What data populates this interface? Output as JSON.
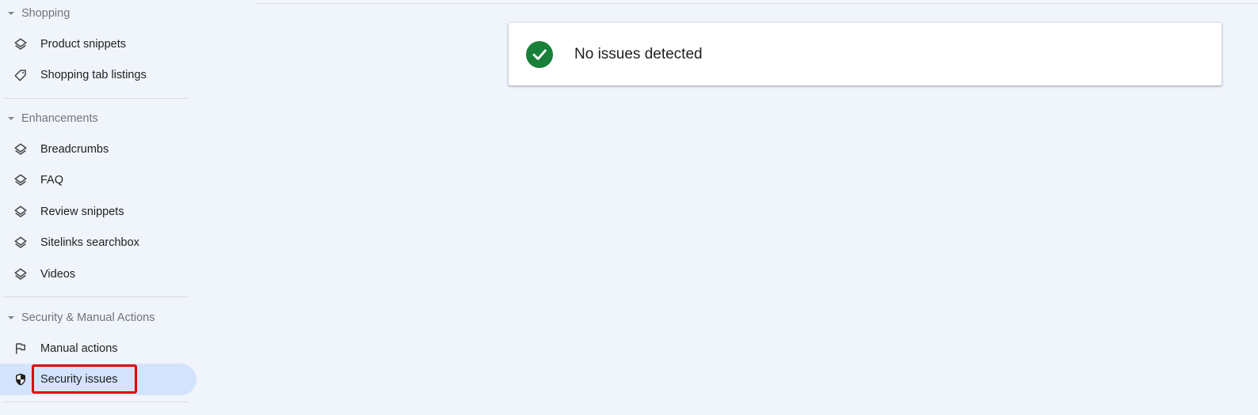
{
  "sidebar": {
    "sections": [
      {
        "title": "Shopping",
        "items": [
          {
            "label": "Product snippets",
            "icon": "layers-icon"
          },
          {
            "label": "Shopping tab listings",
            "icon": "tag-icon"
          }
        ]
      },
      {
        "title": "Enhancements",
        "items": [
          {
            "label": "Breadcrumbs",
            "icon": "layers-icon"
          },
          {
            "label": "FAQ",
            "icon": "layers-icon"
          },
          {
            "label": "Review snippets",
            "icon": "layers-icon"
          },
          {
            "label": "Sitelinks searchbox",
            "icon": "layers-icon"
          },
          {
            "label": "Videos",
            "icon": "layers-icon"
          }
        ]
      },
      {
        "title": "Security & Manual Actions",
        "items": [
          {
            "label": "Manual actions",
            "icon": "flag-icon"
          },
          {
            "label": "Security issues",
            "icon": "shield-icon",
            "active": true
          }
        ]
      }
    ]
  },
  "main": {
    "status_card": {
      "message": "No issues detected",
      "icon": "check-circle-icon",
      "status_color": "#188038"
    }
  },
  "colors": {
    "background": "#f0f4fb",
    "active_item": "#d3e3fd",
    "highlight_border": "#e00000"
  }
}
